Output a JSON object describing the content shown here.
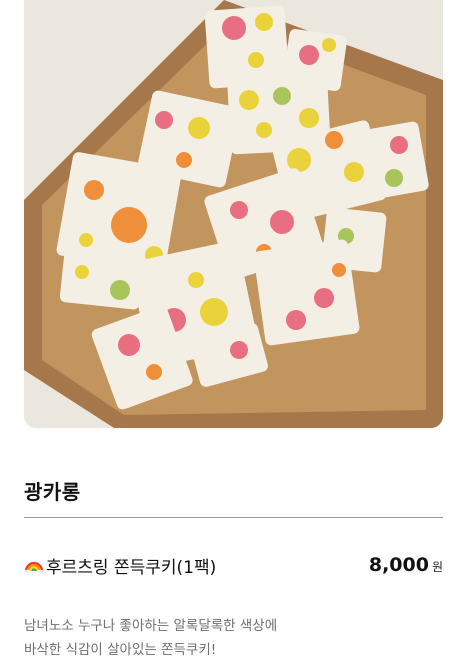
{
  "hero": {
    "image_icon": "cookie-photo",
    "colors": {
      "background": "#ece7de",
      "box": "#b88a5a",
      "cookie": "#f4efe4",
      "pink": "#e86f82",
      "yellow": "#e9d23a",
      "orange": "#ef8f3a",
      "green": "#a9c45a"
    }
  },
  "store": {
    "name": "광카롱"
  },
  "item": {
    "icon": "rainbow-icon",
    "name": "후르츠링 쫀득쿠키(1팩)",
    "price": "8,000",
    "currency": "원"
  },
  "description": {
    "line1": "남녀노소 누구나 좋아하는 알록달록한 색상에",
    "line2": "바삭한 식감이 살아있는 쫀득쿠키!"
  }
}
